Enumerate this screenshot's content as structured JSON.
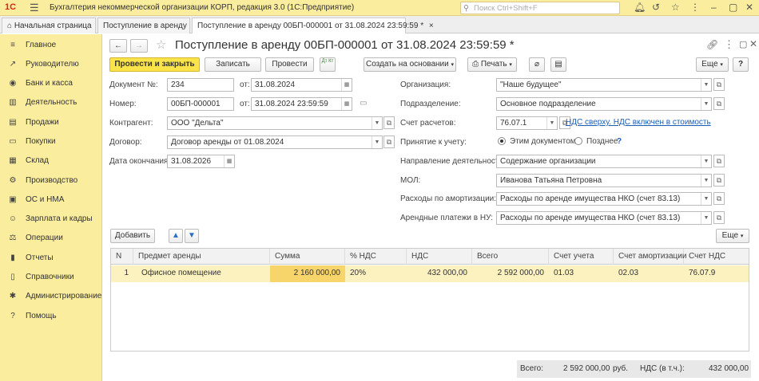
{
  "app": {
    "logo": "1С",
    "title": "Бухгалтерия некоммерческой организации КОРП, редакция 3.0  (1С:Предприятие)",
    "search_placeholder": "Поиск Ctrl+Shift+F"
  },
  "tabs": {
    "home": "Начальная страница",
    "t1": "Поступление в аренду",
    "t2": "Поступление в аренду 00БП-000001 от 31.08.2024 23:59:59 *"
  },
  "sidebar": {
    "items": [
      {
        "label": "Главное",
        "icon": "≡"
      },
      {
        "label": "Руководителю",
        "icon": "↗"
      },
      {
        "label": "Банк и касса",
        "icon": "◉"
      },
      {
        "label": "Деятельность",
        "icon": "▥"
      },
      {
        "label": "Продажи",
        "icon": "▤"
      },
      {
        "label": "Покупки",
        "icon": "▭"
      },
      {
        "label": "Склад",
        "icon": "▦"
      },
      {
        "label": "Производство",
        "icon": "⚙"
      },
      {
        "label": "ОС и НМА",
        "icon": "▣"
      },
      {
        "label": "Зарплата и кадры",
        "icon": "☺"
      },
      {
        "label": "Операции",
        "icon": "⚖"
      },
      {
        "label": "Отчеты",
        "icon": "▮"
      },
      {
        "label": "Справочники",
        "icon": "▯"
      },
      {
        "label": "Администрирование",
        "icon": "✱"
      },
      {
        "label": "Помощь",
        "icon": "?"
      }
    ]
  },
  "doc": {
    "title": "Поступление в аренду 00БП-000001 от 31.08.2024 23:59:59 *"
  },
  "toolbar": {
    "post_close": "Провести и закрыть",
    "save": "Записать",
    "post": "Провести",
    "dtkt": "Дт Кт",
    "create_based": "Создать на основании",
    "print": "Печать",
    "more": "Еще"
  },
  "form": {
    "doc_no_label": "Документ №:",
    "doc_no": "234",
    "from_label": "от:",
    "doc_date": "31.08.2024",
    "number_label": "Номер:",
    "number": "00БП-000001",
    "number_date": "31.08.2024 23:59:59",
    "counterparty_label": "Контрагент:",
    "counterparty": "ООО \"Дельта\"",
    "contract_label": "Договор:",
    "contract": "Договор аренды от 01.08.2024",
    "end_date_label": "Дата окончания:",
    "end_date": "31.08.2026",
    "org_label": "Организация:",
    "org": "\"Наше будущее\"",
    "dept_label": "Подразделение:",
    "dept": "Основное подразделение",
    "account_label": "Счет расчетов:",
    "account": "76.07.1",
    "vat_link": "НДС сверху. НДС включен в стоимость",
    "accept_label": "Принятие к учету:",
    "accept_opt1": "Этим документом",
    "accept_opt2": "Позднее",
    "help": "?",
    "direction_label": "Направление деятельности:",
    "direction": "Содержание организации",
    "mol_label": "МОЛ:",
    "mol": "Иванова Татьяна Петровна",
    "amort_label": "Расходы по амортизации:",
    "amort": "Расходы по аренде имущества НКО (счет 83.13)",
    "rent_nu_label": "Арендные платежи в НУ:",
    "rent_nu": "Расходы по аренде имущества НКО (счет 83.13)"
  },
  "table_toolbar": {
    "add": "Добавить",
    "more": "Еще"
  },
  "table": {
    "headers": [
      "N",
      "Предмет аренды",
      "Сумма",
      "% НДС",
      "НДС",
      "Всего",
      "Счет учета",
      "Счет амортизации",
      "Счет НДС"
    ],
    "rows": [
      [
        "1",
        "Офисное помещение",
        "2 160 000,00",
        "20%",
        "432 000,00",
        "2 592 000,00",
        "01.03",
        "02.03",
        "76.07.9"
      ]
    ]
  },
  "footer": {
    "total_label": "Всего:",
    "total": "2 592 000,00",
    "currency": "руб.",
    "vat_label": "НДС (в т.ч.):",
    "vat": "432 000,00"
  },
  "colors": {
    "accent": "#fbed9e",
    "primary_button": "#fbe34a",
    "selected_row": "#fbf2c0",
    "link": "#1a5eb8"
  }
}
